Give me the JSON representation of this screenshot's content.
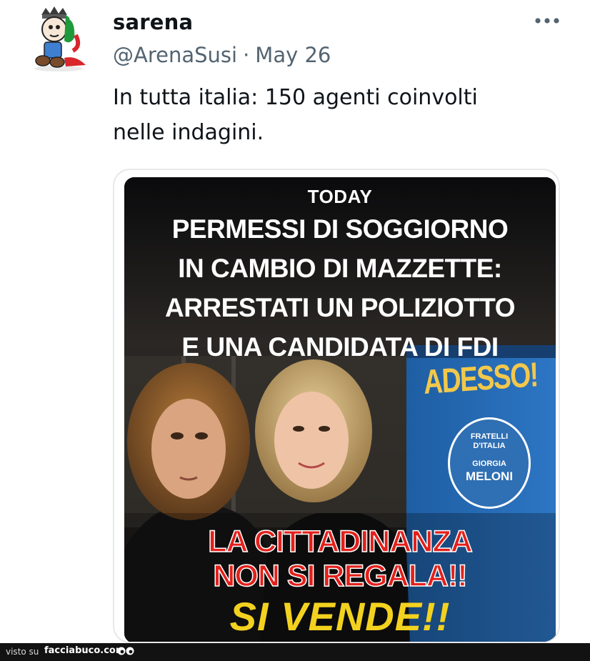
{
  "tweet": {
    "display_name": "sarena",
    "handle": "@ArenaSusi",
    "separator": "·",
    "date": "May 26",
    "more_label": "•••",
    "text": "In tutta italia: 150 agenti coinvolti\nnelle indagini."
  },
  "media": {
    "headline_top": "TODAY",
    "headline_lines": [
      "PERMESSI DI SOGGIORNO",
      "IN CAMBIO DI MAZZETTE:",
      "ARRESTATI UN POLIZIOTTO",
      "E UNA CANDIDATA DI FDI"
    ],
    "poster_text": "ADESSO!",
    "logo_lines": [
      "FRATELLI",
      "D'ITALIA",
      "GIORGIA",
      "MELONI"
    ],
    "slogan_lines": [
      "LA CITTADINANZA",
      "NON SI REGALA!!",
      "SI VENDE!!"
    ]
  },
  "footer": {
    "visto_label": "visto su",
    "brand": "facciabuco.com"
  },
  "colors": {
    "text_primary": "#0f1419",
    "text_secondary": "#536471",
    "slogan_red": "#e3201b",
    "slogan_yellow": "#f3d21f",
    "poster_blue": "#2f6fb3"
  }
}
